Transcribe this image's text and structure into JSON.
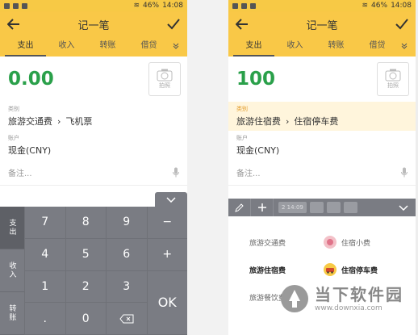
{
  "status_bar": {
    "battery": "46%",
    "time": "14:08"
  },
  "header": {
    "title": "记一笔"
  },
  "tabs": [
    "支出",
    "收入",
    "转账",
    "借贷"
  ],
  "photo_label": "拍照",
  "left": {
    "amount": "0.00",
    "category_label": "类别",
    "category_parent": "旅游交通费",
    "category_child": "飞机票",
    "account_label": "账户",
    "account_value": "现金(CNY)",
    "note_placeholder": "备注..."
  },
  "right": {
    "amount": "100",
    "category_label": "类别",
    "category_parent": "旅游住宿费",
    "category_child": "住宿停车费",
    "account_label": "账户",
    "account_value": "现金(CNY)",
    "note_placeholder": "备注...",
    "toolbar_date": "2 14:09",
    "categories_left": [
      "旅游交通费",
      "旅游住宿费",
      "旅游餐饮费"
    ],
    "categories_right": [
      "住宿小费",
      "住宿停车费"
    ]
  },
  "keypad": {
    "side": [
      "支出",
      "收入",
      "转账"
    ],
    "keys": [
      "7",
      "8",
      "9",
      "−",
      "4",
      "5",
      "6",
      "+",
      "1",
      "2",
      "3",
      ".",
      "0"
    ],
    "ok": "OK"
  },
  "watermark": {
    "cn": "当下软件园",
    "url": "www.downxia.com"
  },
  "colors": {
    "accent": "#f9c847",
    "amount_green": "#2aa04a",
    "keypad": "#7a7c83"
  }
}
